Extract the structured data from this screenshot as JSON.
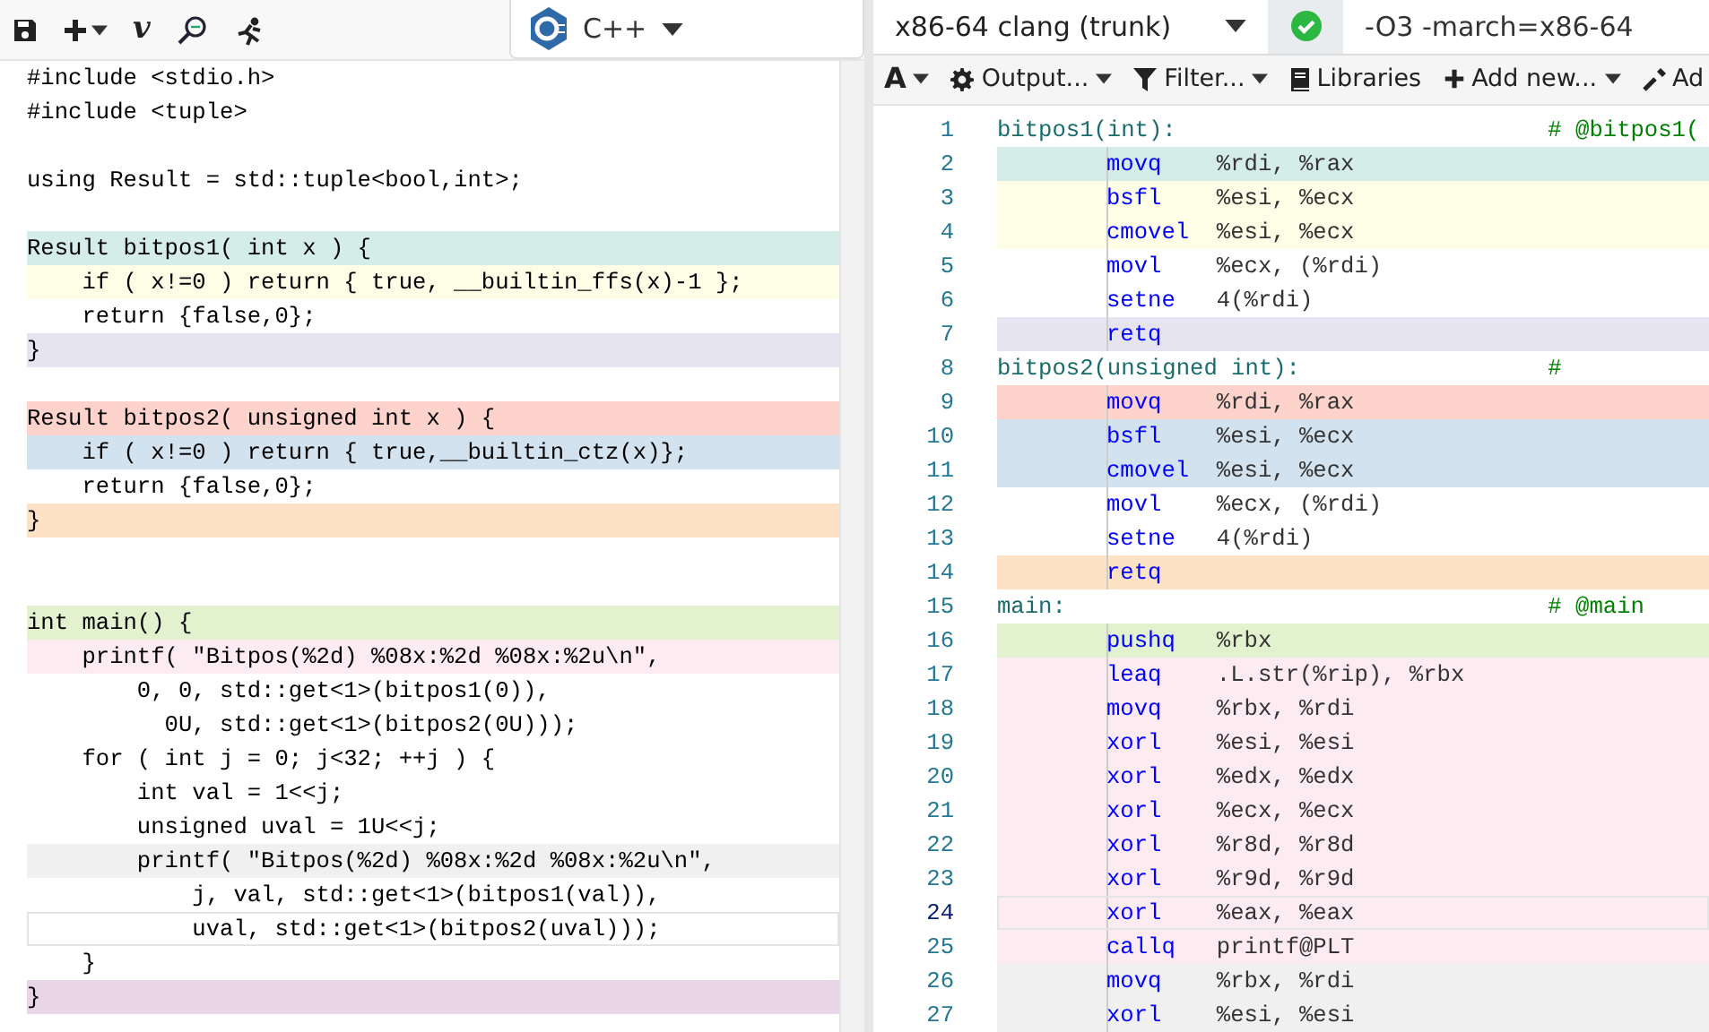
{
  "editor": {
    "toolbar": {
      "vim_label": "v",
      "language": "C++"
    },
    "lines": [
      {
        "text": "#include <stdio.h>",
        "current": false
      },
      {
        "text": "#include <tuple>",
        "current": false
      },
      {
        "text": "using Result = std::tuple<bool,int>;",
        "blank_before": true,
        "current": false
      },
      {
        "text": "Result bitpos1( int x ) {",
        "blank_before": true,
        "color": "#d5ede8",
        "current": false
      },
      {
        "text": "    if ( x!=0 ) return { true, __builtin_ffs(x)-1 };",
        "color": "#fefde6",
        "current": false
      },
      {
        "text": "    return {false,0};",
        "current": false
      },
      {
        "text": "}",
        "color": "#e6e4f0",
        "current": false
      },
      {
        "text": "Result bitpos2( unsigned int x ) {",
        "blank_before": true,
        "color": "#fdd3cc",
        "current": false
      },
      {
        "text": "    if ( x!=0 ) return { true,__builtin_ctz(x)};",
        "color": "#d3e2ef",
        "current": false
      },
      {
        "text": "    return {false,0};",
        "current": false
      },
      {
        "text": "}",
        "color": "#fde2c6",
        "current": false
      },
      {
        "text": "int main() {",
        "blank_before": true,
        "second_blank_before": true,
        "color": "#e2f2cf",
        "current": false
      },
      {
        "text": "    printf( \"Bitpos(%2d) %08x:%2d %08x:%2u\\n\",",
        "color": "#fdebf2",
        "current": false
      },
      {
        "text": "        0, 0, std::get<1>(bitpos1(0)),",
        "current": false
      },
      {
        "text": "          0U, std::get<1>(bitpos2(0U)));",
        "current": false
      },
      {
        "text": "    for ( int j = 0; j<32; ++j ) {",
        "current": false
      },
      {
        "text": "        int val = 1<<j;",
        "current": false
      },
      {
        "text": "        unsigned uval = 1U<<j;",
        "current": false
      },
      {
        "text": "        printf( \"Bitpos(%2d) %08x:%2d %08x:%2u\\n\",",
        "color": "#f0f0f0",
        "current": false
      },
      {
        "text": "            j, val, std::get<1>(bitpos1(val)),",
        "current": false
      },
      {
        "text": "            uval, std::get<1>(bitpos2(uval)));",
        "current": true
      },
      {
        "text": "    }",
        "current": false
      },
      {
        "text": "}",
        "color": "#e8d5e8",
        "current": false
      }
    ]
  },
  "compiler": {
    "name": "x86-64 clang (trunk)",
    "success": true,
    "options": "-O3 -march=x86-64",
    "toolbar": [
      {
        "kind": "font",
        "label": "A",
        "caret": true
      },
      {
        "kind": "gear",
        "label": "Output...",
        "caret": true
      },
      {
        "kind": "filter",
        "label": "Filter...",
        "caret": true
      },
      {
        "kind": "book",
        "label": "Libraries",
        "caret": false
      },
      {
        "kind": "plus",
        "label": "Add new...",
        "caret": true
      },
      {
        "kind": "wrench",
        "label": "Ad",
        "caret": false
      }
    ],
    "asm": [
      {
        "kind": "label",
        "num": "1",
        "label": "bitpos1(int):",
        "comment": "# @bitpos1(",
        "current": false
      },
      {
        "kind": "instr",
        "num": "2",
        "mnemonic": "movq",
        "operands": "%rdi, %rax",
        "color": "#d5ede8",
        "current": false
      },
      {
        "kind": "instr",
        "num": "3",
        "mnemonic": "bsfl",
        "operands": "%esi, %ecx",
        "color": "#fefde6",
        "current": false
      },
      {
        "kind": "instr",
        "num": "4",
        "mnemonic": "cmovel",
        "operands": "%esi, %ecx",
        "color": "#fefde6",
        "current": false
      },
      {
        "kind": "instr",
        "num": "5",
        "mnemonic": "movl",
        "operands": "%ecx, (%rdi)",
        "current": false
      },
      {
        "kind": "instr",
        "num": "6",
        "mnemonic": "setne",
        "operands": "4(%rdi)",
        "current": false
      },
      {
        "kind": "instr",
        "num": "7",
        "mnemonic": "retq",
        "color": "#e6e4f0",
        "current": false
      },
      {
        "kind": "label",
        "num": "8",
        "label": "bitpos2(unsigned int):",
        "comment": "#",
        "current": false
      },
      {
        "kind": "instr",
        "num": "9",
        "mnemonic": "movq",
        "operands": "%rdi, %rax",
        "color": "#fdd3cc",
        "current": false
      },
      {
        "kind": "instr",
        "num": "10",
        "mnemonic": "bsfl",
        "operands": "%esi, %ecx",
        "color": "#d3e2ef",
        "current": false
      },
      {
        "kind": "instr",
        "num": "11",
        "mnemonic": "cmovel",
        "operands": "%esi, %ecx",
        "color": "#d3e2ef",
        "current": false
      },
      {
        "kind": "instr",
        "num": "12",
        "mnemonic": "movl",
        "operands": "%ecx, (%rdi)",
        "current": false
      },
      {
        "kind": "instr",
        "num": "13",
        "mnemonic": "setne",
        "operands": "4(%rdi)",
        "current": false
      },
      {
        "kind": "instr",
        "num": "14",
        "mnemonic": "retq",
        "color": "#fde2c6",
        "current": false
      },
      {
        "kind": "label",
        "num": "15",
        "label": "main:",
        "comment": "# @main",
        "current": false
      },
      {
        "kind": "instr",
        "num": "16",
        "mnemonic": "pushq",
        "operands": "%rbx",
        "color": "#e2f2cf",
        "current": false
      },
      {
        "kind": "instr",
        "num": "17",
        "mnemonic": "leaq",
        "operands": ".L.str(%rip), %rbx",
        "color": "#fdebf2",
        "current": false
      },
      {
        "kind": "instr",
        "num": "18",
        "mnemonic": "movq",
        "operands": "%rbx, %rdi",
        "color": "#fdebf2",
        "current": false
      },
      {
        "kind": "instr",
        "num": "19",
        "mnemonic": "xorl",
        "operands": "%esi, %esi",
        "color": "#fdebf2",
        "current": false
      },
      {
        "kind": "instr",
        "num": "20",
        "mnemonic": "xorl",
        "operands": "%edx, %edx",
        "color": "#fdebf2",
        "current": false
      },
      {
        "kind": "instr",
        "num": "21",
        "mnemonic": "xorl",
        "operands": "%ecx, %ecx",
        "color": "#fdebf2",
        "current": false
      },
      {
        "kind": "instr",
        "num": "22",
        "mnemonic": "xorl",
        "operands": "%r8d, %r8d",
        "color": "#fdebf2",
        "current": false
      },
      {
        "kind": "instr",
        "num": "23",
        "mnemonic": "xorl",
        "operands": "%r9d, %r9d",
        "color": "#fdebf2",
        "current": false
      },
      {
        "kind": "instr",
        "num": "24",
        "mnemonic": "xorl",
        "operands": "%eax, %eax",
        "color": "#fdebf2",
        "current": true
      },
      {
        "kind": "instr",
        "num": "25",
        "mnemonic": "callq",
        "operands": "printf@PLT",
        "color": "#fdebf2",
        "current": false
      },
      {
        "kind": "instr",
        "num": "26",
        "mnemonic": "movq",
        "operands": "%rbx, %rdi",
        "color": "#f0f0f0",
        "current": false
      },
      {
        "kind": "instr",
        "num": "27",
        "mnemonic": "xorl",
        "operands": "%esi, %esi",
        "color": "#f0f0f0",
        "current": false
      }
    ]
  }
}
